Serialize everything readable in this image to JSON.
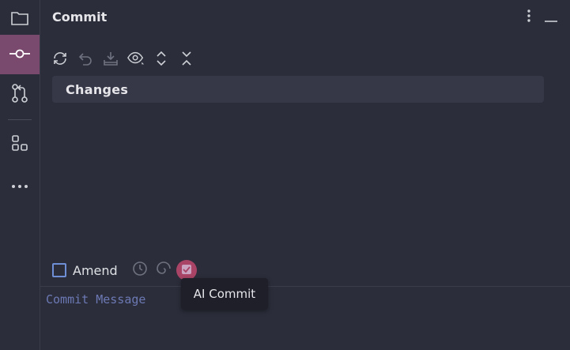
{
  "colors": {
    "accent": "#7a4a6e",
    "background": "#2b2d3a",
    "ai_button": "#a94466"
  },
  "left_toolbar": {
    "items": [
      {
        "icon": "folder-icon"
      },
      {
        "icon": "commit-icon",
        "active": true
      },
      {
        "icon": "pull-request-icon"
      },
      {
        "icon": "structure-icon"
      },
      {
        "icon": "more-icon"
      }
    ]
  },
  "panel": {
    "title": "Commit",
    "actions": [
      "more-vertical-icon",
      "minimize-icon"
    ]
  },
  "toolbar": {
    "icons": [
      "refresh-icon",
      "rollback-icon",
      "shelve-icon",
      "view-options-icon",
      "expand-all-icon",
      "collapse-all-icon"
    ]
  },
  "changes": {
    "label": "Changes"
  },
  "amend": {
    "label": "Amend",
    "checked": false
  },
  "commit_message": {
    "placeholder": "Commit Message"
  },
  "tooltip": {
    "text": "AI Commit"
  }
}
